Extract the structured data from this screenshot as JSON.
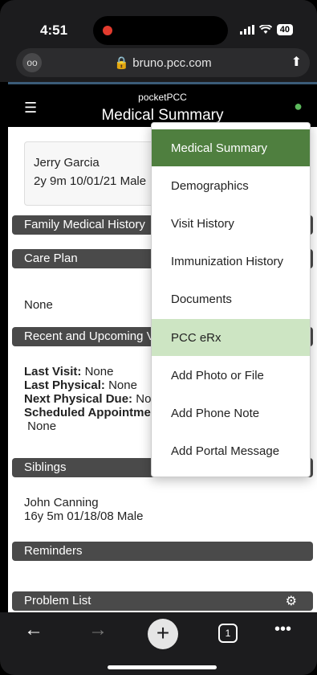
{
  "status_bar": {
    "time": "4:51",
    "battery": "40"
  },
  "browser": {
    "url": "bruno.pcc.com"
  },
  "header": {
    "brand": "pocketPCC",
    "title": "Medical Summary"
  },
  "patient": {
    "name": "Jerry Garcia",
    "info": "2y 9m  10/01/21  Male"
  },
  "sections": {
    "family_history": "Family Medical History",
    "care_plan": "Care Plan",
    "care_plan_value": "None",
    "recent_visits": "Recent and Upcoming Visits",
    "last_visit_label": "Last Visit:",
    "last_visit_value": "None",
    "last_physical_label": "Last Physical:",
    "last_physical_value": "None",
    "next_physical_label": "Next Physical Due:",
    "next_physical_value": "None",
    "scheduled_label": "Scheduled Appointments:",
    "scheduled_value": "None",
    "siblings": "Siblings",
    "sibling_name": "John Canning",
    "sibling_info": "16y 5m  01/18/08  Male",
    "reminders": "Reminders",
    "problem_list": "Problem List"
  },
  "menu": {
    "items": [
      "Medical Summary",
      "Demographics",
      "Visit History",
      "Immunization History",
      "Documents",
      "PCC eRx",
      "Add Photo or File",
      "Add Phone Note",
      "Add Portal Message"
    ],
    "active_index": 0,
    "hover_index": 5
  },
  "toolbar": {
    "tab_count": "1"
  },
  "colors": {
    "accent_green": "#4f7f3f",
    "hover_green": "#cde5c3",
    "section_gray": "#4a4a4a",
    "user_icon": "#5cb85c"
  },
  "icons": [
    "menu-icon",
    "user-icon",
    "lock-icon",
    "share-icon",
    "gear-icon",
    "back-icon",
    "forward-icon",
    "plus-icon",
    "tabs-icon",
    "more-icon"
  ]
}
